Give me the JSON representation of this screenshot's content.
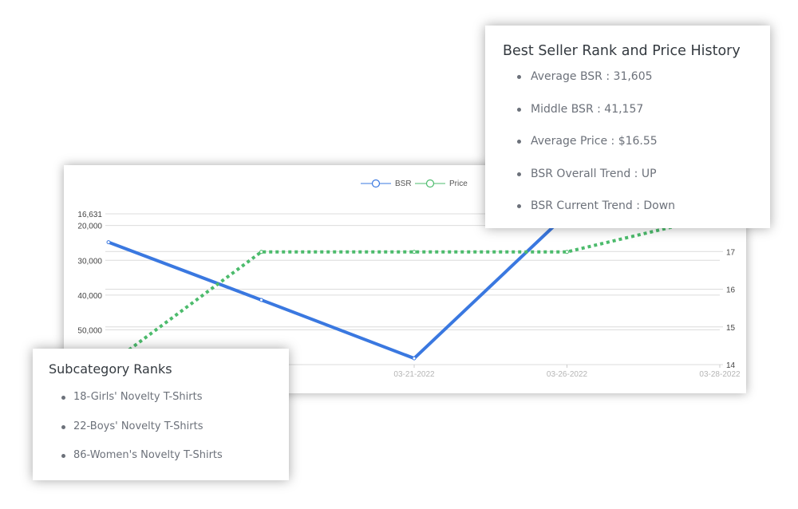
{
  "chart_data": {
    "type": "line",
    "categories": [
      "",
      "",
      "03-21-2022",
      "03-26-2022",
      "03-28-2022"
    ],
    "series": [
      {
        "name": "BSR",
        "axis": "left",
        "values": [
          24800,
          41400,
          58200,
          16631,
          null
        ],
        "color": "#3a78e0",
        "style": "solid"
      },
      {
        "name": "Price",
        "axis": "right",
        "values": [
          13.99,
          16.99,
          16.99,
          16.99,
          17.95
        ],
        "color": "#4cbb6c",
        "style": "dotted"
      }
    ],
    "y_left": {
      "ticks": [
        "16,631",
        "20,000",
        "30,000",
        "40,000",
        "50,000"
      ],
      "tick_values": [
        16631,
        20000,
        30000,
        40000,
        50000
      ],
      "ylim": [
        16631,
        60000
      ],
      "inverted": true
    },
    "y_right": {
      "ticks": [
        "14",
        "15",
        "16",
        "17"
      ],
      "tick_values": [
        14,
        15,
        16,
        17
      ],
      "ylim": [
        14,
        18
      ]
    },
    "grid": true,
    "legend": "top-center"
  },
  "bsr_card": {
    "title": "Best Seller Rank and Price History",
    "items": [
      "Average BSR : 31,605",
      "Middle BSR : 41,157",
      "Average Price : $16.55",
      "BSR Overall Trend : UP",
      "BSR Current Trend : Down"
    ]
  },
  "sub_card": {
    "title": "Subcategory Ranks",
    "items": [
      "18-Girls' Novelty T-Shirts",
      "22-Boys' Novelty T-Shirts",
      "86-Women's Novelty T-Shirts"
    ]
  }
}
